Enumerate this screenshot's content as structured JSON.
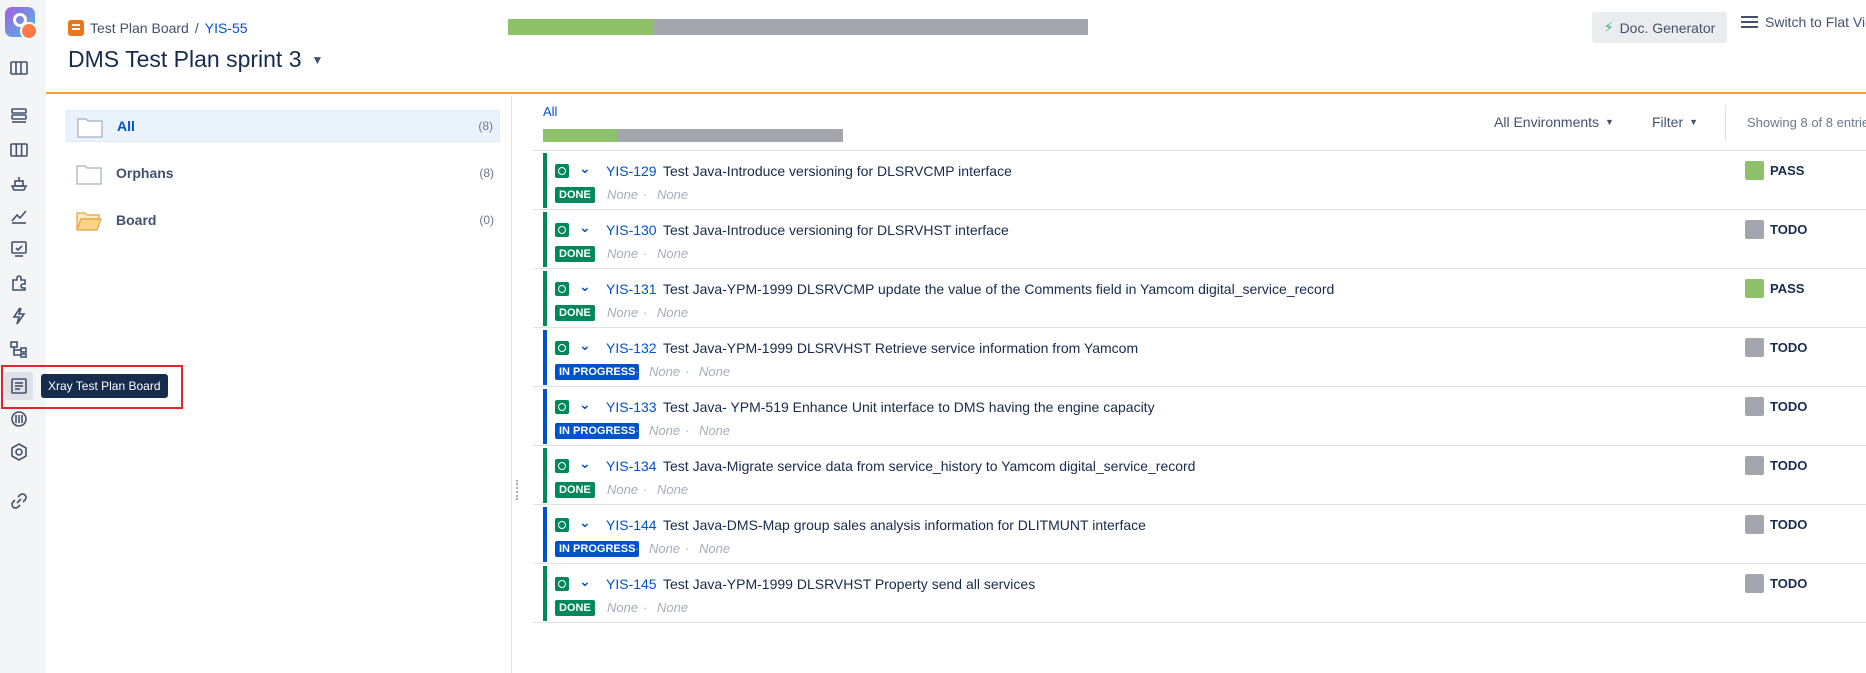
{
  "breadcrumb": {
    "board": "Test Plan Board",
    "separator": "/",
    "issue_key": "YIS-55"
  },
  "title": "DMS Test Plan sprint 3",
  "toolbar": {
    "doc_generator": "Doc. Generator",
    "flat_view": "Switch to Flat Vie"
  },
  "tooltip": "Xray Test Plan Board",
  "progress": {
    "pass_fraction": 0.25,
    "todo_fraction": 0.75
  },
  "colors": {
    "pass": "#8fc16b",
    "todo": "#a3a7ad",
    "done": "#00875a",
    "in_progress": "#0052cc",
    "accent": "#f5a623"
  },
  "folders": [
    {
      "label": "All",
      "count": "(8)"
    },
    {
      "label": "Orphans",
      "count": "(8)"
    },
    {
      "label": "Board",
      "count": "(0)"
    }
  ],
  "list": {
    "heading": "All",
    "env_filter": "All Environments",
    "filter": "Filter",
    "showing": "Showing 8 of 8 entrie"
  },
  "tests": [
    {
      "key": "YIS-129",
      "summary": "Test Java-Introduce versioning for DLSRVCMP interface",
      "status": "DONE",
      "meta1": "None",
      "meta2": "None",
      "result": "PASS"
    },
    {
      "key": "YIS-130",
      "summary": "Test Java-Introduce versioning for DLSRVHST interface",
      "status": "DONE",
      "meta1": "None",
      "meta2": "None",
      "result": "TODO"
    },
    {
      "key": "YIS-131",
      "summary": "Test Java-YPM-1999 DLSRVCMP update the value of the Comments field in Yamcom digital_service_record",
      "status": "DONE",
      "meta1": "None",
      "meta2": "None",
      "result": "PASS"
    },
    {
      "key": "YIS-132",
      "summary": "Test Java-YPM-1999 DLSRVHST Retrieve service information from Yamcom",
      "status": "IN PROGRESS",
      "meta1": "None",
      "meta2": "None",
      "result": "TODO"
    },
    {
      "key": "YIS-133",
      "summary": "Test Java- YPM-519 Enhance Unit interface to DMS having the engine capacity",
      "status": "IN PROGRESS",
      "meta1": "None",
      "meta2": "None",
      "result": "TODO"
    },
    {
      "key": "YIS-134",
      "summary": "Test Java-Migrate service data from service_history to Yamcom digital_service_record",
      "status": "DONE",
      "meta1": "None",
      "meta2": "None",
      "result": "TODO"
    },
    {
      "key": "YIS-144",
      "summary": "Test Java-DMS-Map group sales analysis information for DLITMUNT interface",
      "status": "IN PROGRESS",
      "meta1": "None",
      "meta2": "None",
      "result": "TODO"
    },
    {
      "key": "YIS-145",
      "summary": "Test Java-YPM-1999 DLSRVHST Property send all services",
      "status": "DONE",
      "meta1": "None",
      "meta2": "None",
      "result": "TODO"
    }
  ],
  "rail_icons": [
    "app-logo-icon",
    "board-icon",
    "backlog-icon",
    "columns-icon",
    "ship-icon",
    "chart-icon",
    "test-execution-icon",
    "puzzle-icon",
    "bolt-icon",
    "hierarchy-icon",
    "test-plan-board-icon",
    "repository-icon",
    "settings-hex-icon",
    "link-icon"
  ]
}
